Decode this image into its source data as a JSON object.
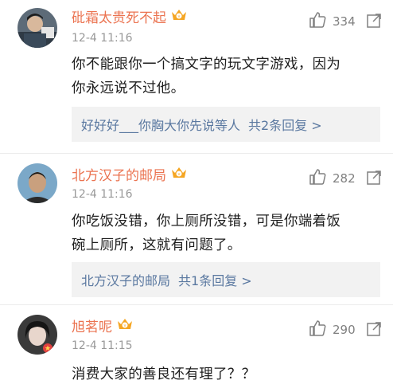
{
  "comments": [
    {
      "username": "砒霜太贵死不起",
      "time": "12-4 11:16",
      "likes": "334",
      "lines": [
        "你不能跟你一个搞文字的玩文字游戏，因为",
        "你永远说不过他。"
      ],
      "reply_preview": "好好好___你胸大你先说等人",
      "reply_more": "共2条回复 >"
    },
    {
      "username": "北方汉子的邮局",
      "time": "12-4 11:16",
      "likes": "282",
      "lines": [
        "你吃饭没错，你上厕所没错，可是你端着饭",
        "碗上厕所，这就有问题了。"
      ],
      "reply_preview": "北方汉子的邮局",
      "reply_more": "共1条回复 >"
    },
    {
      "username": "旭茗呢",
      "time": "12-4 11:15",
      "likes": "290",
      "lines": [
        "消费大家的善良还有理了？？"
      ]
    }
  ],
  "colors": {
    "username": "#eb7350",
    "reply_link": "#5a78a0",
    "meta": "#999999",
    "badge": "#f5a623"
  },
  "icons": {
    "like": "thumbs-up-icon",
    "share": "share-icon",
    "badge": "vip-crown-badge-icon"
  }
}
